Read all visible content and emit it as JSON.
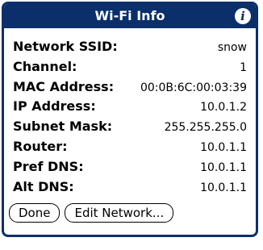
{
  "dialog": {
    "title": "Wi-Fi Info",
    "info_icon": "i",
    "info_icon_name": "info-icon"
  },
  "fields": [
    {
      "label": "Network SSID:",
      "value": "snow"
    },
    {
      "label": "Channel:",
      "value": "1"
    },
    {
      "label": "MAC Address:",
      "value": "00:0B:6C:00:03:39"
    },
    {
      "label": "IP Address:",
      "value": "10.0.1.2"
    },
    {
      "label": "Subnet Mask:",
      "value": "255.255.255.0"
    },
    {
      "label": "Router:",
      "value": "10.0.1.1"
    },
    {
      "label": "Pref DNS:",
      "value": "10.0.1.1"
    },
    {
      "label": "Alt DNS:",
      "value": "10.0.1.1"
    }
  ],
  "buttons": {
    "done_label": "Done",
    "edit_network_label": "Edit Network..."
  },
  "colors": {
    "title_bar": "#0b2f6b",
    "title_text": "#ffffff",
    "border": "#0b2f6b"
  }
}
